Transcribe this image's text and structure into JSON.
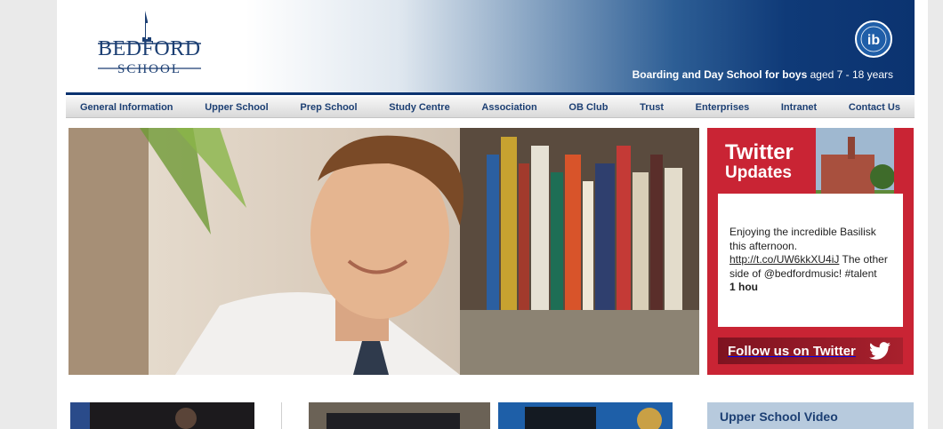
{
  "header": {
    "logo_bedford": "BEDFORD",
    "logo_school": "SCHOOL",
    "tagline_bold": "Boarding and Day School for boys",
    "tagline_rest": " aged 7 - 18 years",
    "ib_icon": "ib-world-school-icon"
  },
  "nav": {
    "items": [
      {
        "label": "General Information"
      },
      {
        "label": "Upper School"
      },
      {
        "label": "Prep School"
      },
      {
        "label": "Study Centre"
      },
      {
        "label": "Association"
      },
      {
        "label": "OB Club"
      },
      {
        "label": "Trust"
      },
      {
        "label": "Enterprises"
      },
      {
        "label": "Intranet"
      },
      {
        "label": "Contact Us"
      }
    ]
  },
  "twitter": {
    "title_line1": "Twitter",
    "title_line2": "Updates",
    "tweet_text1": "Enjoying the incredible Basilisk this afternoon.",
    "tweet_link": "http://t.co/UW6kkXU4iJ",
    "tweet_text2": " The other side of @bedfordmusic! #talent",
    "tweet_time": "1 hou",
    "follow_label": "Follow us on Twitter",
    "accent_color": "#c92434"
  },
  "video": {
    "title": "Upper School Video"
  },
  "colors": {
    "brand_navy": "#0b3370",
    "nav_text": "#1c3f73"
  }
}
